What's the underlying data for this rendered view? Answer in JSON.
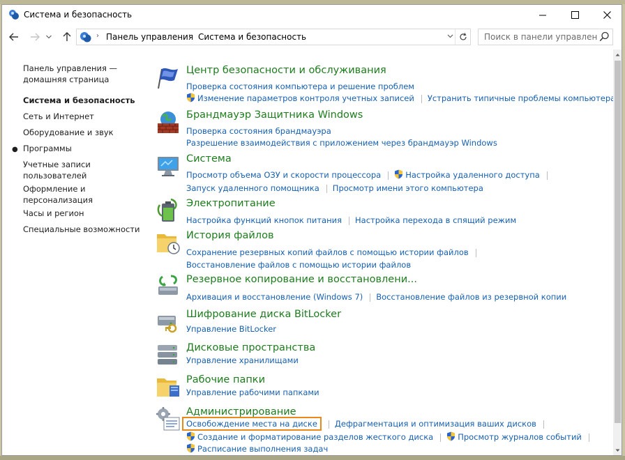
{
  "window": {
    "title": "Система и безопасность",
    "controls": [
      "minimize-icon",
      "maximize-icon",
      "close-icon"
    ]
  },
  "address_bar": {
    "breadcrumbs": [
      "Панель управления",
      "Система и безопасность"
    ],
    "search_placeholder": "Поиск в панели управления"
  },
  "sidebar": {
    "items": [
      {
        "label": "Панель управления — домашняя страница",
        "active": false
      },
      {
        "label": "Система и безопасность",
        "active": true
      },
      {
        "label": "Сеть и Интернет",
        "active": false
      },
      {
        "label": "Оборудование и звук",
        "active": false
      },
      {
        "label": "Программы",
        "active": false
      },
      {
        "label": "Учетные записи пользователей",
        "active": false
      },
      {
        "label": "Оформление и персонализация",
        "active": false
      },
      {
        "label": "Часы и регион",
        "active": false
      },
      {
        "label": "Специальные возможности",
        "active": false
      }
    ]
  },
  "categories": [
    {
      "title": "Центр безопасности и обслуживания",
      "icon": "security-flag-icon",
      "rows": [
        [
          {
            "label": "Проверка состояния компьютера и решение проблем",
            "shield": false
          }
        ],
        [
          {
            "label": "Изменение параметров контроля учетных записей",
            "shield": true
          },
          {
            "label": "Устранить типичные проблемы компьютера",
            "shield": false
          }
        ]
      ]
    },
    {
      "title": "Брандмауэр Защитника Windows",
      "icon": "firewall-icon",
      "rows": [
        [
          {
            "label": "Проверка состояния брандмауэра",
            "shield": false
          }
        ],
        [
          {
            "label": "Разрешение взаимодействия с приложением через брандмауэр Windows",
            "shield": false
          }
        ]
      ]
    },
    {
      "title": "Система",
      "icon": "system-monitor-icon",
      "rows": [
        [
          {
            "label": "Просмотр объема ОЗУ и скорости процессора",
            "shield": false
          },
          {
            "label": "Настройка удаленного доступа",
            "shield": true
          }
        ],
        [
          {
            "label": "Запуск удаленного помощника",
            "shield": false
          },
          {
            "label": "Просмотр имени этого компьютера",
            "shield": false
          }
        ]
      ]
    },
    {
      "title": "Электропитание",
      "icon": "power-battery-icon",
      "rows": [
        [
          {
            "label": "Настройка функций кнопок питания",
            "shield": false
          },
          {
            "label": "Настройка перехода в спящий режим",
            "shield": false
          }
        ]
      ]
    },
    {
      "title": "История файлов",
      "icon": "file-history-icon",
      "rows": [
        [
          {
            "label": "Сохранение резервных копий файлов с помощью истории файлов",
            "shield": false
          }
        ],
        [
          {
            "label": "Восстановление файлов с помощью истории файлов",
            "shield": false
          }
        ]
      ]
    },
    {
      "title": "Резервное копирование и восстановлени...",
      "icon": "backup-restore-icon",
      "rows": [
        [
          {
            "label": "Архивация и восстановление (Windows 7)",
            "shield": false
          },
          {
            "label": "Восстановление файлов из резервной копии",
            "shield": false
          }
        ]
      ]
    },
    {
      "title": "Шифрование диска BitLocker",
      "icon": "bitlocker-drive-icon",
      "rows": [
        [
          {
            "label": "Управление BitLocker",
            "shield": false
          }
        ]
      ]
    },
    {
      "title": "Дисковые пространства",
      "icon": "storage-spaces-icon",
      "rows": [
        [
          {
            "label": "Управление хранилищами",
            "shield": false
          }
        ]
      ]
    },
    {
      "title": "Рабочие папки",
      "icon": "work-folders-icon",
      "rows": [
        [
          {
            "label": "Управление рабочими папками",
            "shield": false
          }
        ]
      ]
    },
    {
      "title": "Администрирование",
      "icon": "admin-tools-icon",
      "rows": [
        [
          {
            "label": "Освобождение места на диске",
            "shield": false,
            "highlight": true
          },
          {
            "label": "Дефрагментация и оптимизация ваших дисков",
            "shield": false
          }
        ],
        [
          {
            "label": "Создание и форматирование разделов жесткого диска",
            "shield": true
          },
          {
            "label": "Просмотр журналов событий",
            "shield": true
          }
        ],
        [
          {
            "label": "Расписание выполнения задач",
            "shield": true
          }
        ]
      ]
    }
  ],
  "colors": {
    "category_title": "#1d7d1d",
    "link": "#1760b0",
    "highlight_border": "#e8891a"
  }
}
